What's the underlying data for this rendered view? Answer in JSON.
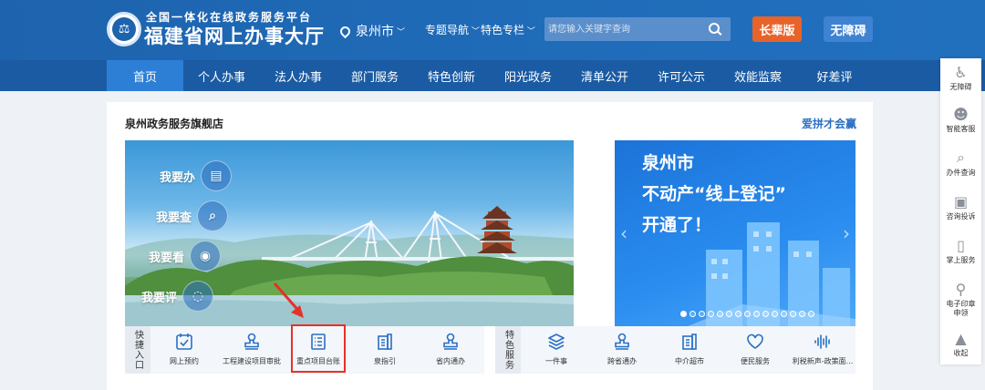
{
  "header": {
    "platform_subtitle": "全国一体化在线政务服务平台",
    "platform_title": "福建省网上办事大厅",
    "city": "泉州市",
    "nav_topics": "专题导航",
    "nav_features": "特色专栏",
    "search_placeholder": "请您输入关键字查询",
    "elder_button": "长辈版",
    "accessibility_button": "无障碍"
  },
  "main_nav": [
    "首页",
    "个人办事",
    "法人办事",
    "部门服务",
    "特色创新",
    "阳光政务",
    "清单公开",
    "许可公示",
    "效能监察",
    "好差评"
  ],
  "panel": {
    "title": "泉州政务服务旗舰店",
    "link": "爱拼才会赢"
  },
  "hero_actions": [
    "我要办",
    "我要查",
    "我要看",
    "我要评"
  ],
  "promo": {
    "line1": "泉州市",
    "line2": "不动产“线上登记”",
    "line3": "开通了！"
  },
  "quick_entry": {
    "label": "快捷入口",
    "items": [
      "网上预约",
      "工程建设项目审批",
      "重点项目台账",
      "泉指引",
      "省内通办"
    ]
  },
  "special_services": {
    "label": "特色服务",
    "items": [
      "一件事",
      "跨省通办",
      "中介超市",
      "便民服务",
      "利税新声-政策面..."
    ]
  },
  "sidebar": [
    "无障碍",
    "智能客服",
    "办件查询",
    "咨询投诉",
    "掌上服务",
    "电子印章申领",
    "收起"
  ],
  "colors": {
    "header_blue": "#1e63ad",
    "nav_blue": "#1b5ba3",
    "active_tab": "#2d7fd6",
    "elder_orange": "#e8632a",
    "icon_blue": "#2a6fc4",
    "highlight_red": "#e6302a"
  }
}
